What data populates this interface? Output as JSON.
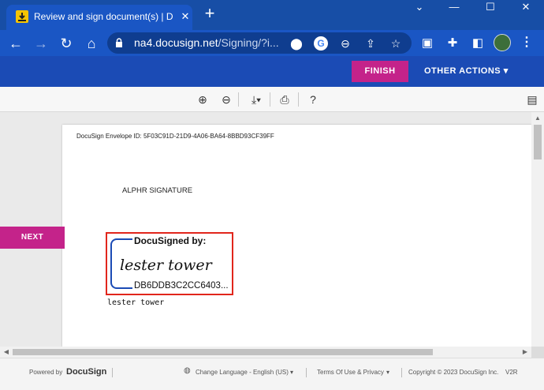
{
  "browser": {
    "tab_title": "Review and sign document(s) | D",
    "tab_close": "✕",
    "new_tab": "+",
    "url_host": "na4.docusign.net",
    "url_path": "/Signing/?i...",
    "window_controls": {
      "chevron": "⌄",
      "minimize": "—",
      "maximize": "☐",
      "close": "✕"
    }
  },
  "docusign_header": {
    "finish_label": "FINISH",
    "other_actions_label": "OTHER ACTIONS ▾",
    "colors": {
      "header": "#1b4bb5",
      "accent": "#c4238a"
    }
  },
  "document": {
    "envelope_id": "DocuSign Envelope ID: 5F03C91D-21D9-4A06-BA64-8BBD93CF39FF",
    "heading": "ALPHR SIGNATURE",
    "signature": {
      "label": "DocuSigned by:",
      "handwritten_name": "lester tower",
      "hash": "DB6DDB3C2CC6403...",
      "highlight_color": "#e1261c"
    },
    "typed_name": "lester tower"
  },
  "next_label": "NEXT",
  "footer": {
    "powered_by": "Powered by",
    "brand": "DocuSign",
    "change_language": "Change Language - English (US)",
    "terms": "Terms Of Use & Privacy",
    "copyright": "Copyright © 2023 DocuSign Inc.",
    "version": "V2R"
  }
}
